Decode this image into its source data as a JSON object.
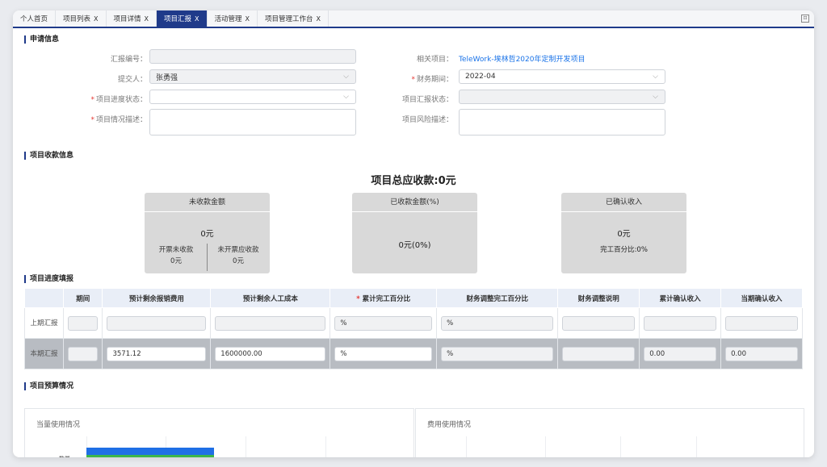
{
  "tabs": [
    {
      "label": "个人首页",
      "close": ""
    },
    {
      "label": "项目列表",
      "close": "X"
    },
    {
      "label": "项目详情",
      "close": "X"
    },
    {
      "label": "项目汇报",
      "close": "X"
    },
    {
      "label": "活动管理",
      "close": "X"
    },
    {
      "label": "项目管理工作台",
      "close": "X"
    }
  ],
  "tab_more_icon": "⊡",
  "apply": {
    "title": "申请信息",
    "report_no_label": "汇报编号：",
    "report_no_value": "",
    "submitter_label": "提交人：",
    "submitter_value": "张勇强",
    "progress_status_label": "项目进度状态：",
    "progress_status_value": "",
    "situation_label": "项目情况描述：",
    "situation_value": "",
    "related_project_label": "相关项目：",
    "related_project_value": "TeleWork-埃林哲2020年定制开发项目",
    "finance_period_label": "财务期间：",
    "finance_period_value": "2022-04",
    "report_status_label": "项目汇报状态：",
    "report_status_value": "",
    "risk_label": "项目风险描述：",
    "risk_value": "",
    "required_mark": "*",
    "chevron": "⌵"
  },
  "receivable": {
    "title": "项目收款信息",
    "total": "项目总应收款:0元",
    "card1": {
      "header": "未收款金额",
      "value": "0元",
      "left_label": "开票未收款",
      "left_value": "0元",
      "right_label": "未开票应收款",
      "right_value": "0元"
    },
    "card2": {
      "header": "已收款金额(%)",
      "value": "0元(0%)"
    },
    "card3": {
      "header": "已确认收入",
      "value": "0元",
      "sub": "完工百分比:0%"
    }
  },
  "progress": {
    "title": "项目进度填报",
    "columns": [
      "期间",
      "预计剩余报销费用",
      "预计剩余人工成本",
      "累计完工百分比",
      "财务调整完工百分比",
      "财务调整说明",
      "累计确认收入",
      "当期确认收入"
    ],
    "required_col_mark": "*",
    "rows": [
      {
        "label": "上期汇报",
        "cells": [
          "",
          "",
          "",
          "%",
          "%",
          "",
          "",
          ""
        ]
      },
      {
        "label": "本期汇报",
        "cells": [
          "",
          "3571.12",
          "1600000.00",
          "%",
          "%",
          "",
          "0.00",
          "0.00"
        ]
      }
    ]
  },
  "budget": {
    "title": "项目预算情况",
    "panel1_title": "当量使用情况",
    "panel1_axis_label": "数量",
    "panel2_title": "费用使用情况",
    "colors": {
      "blue": "#1f6fe5",
      "green": "#3cb54a",
      "yellow": "#f2b705",
      "accent": "#1f3a8a"
    }
  }
}
